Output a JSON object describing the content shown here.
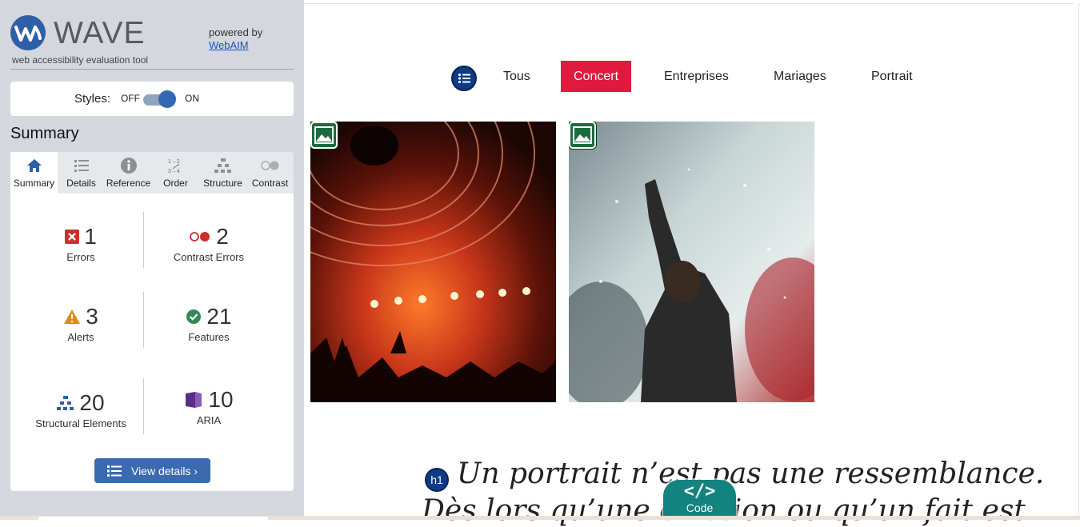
{
  "wave": {
    "logo_text": "WAVE",
    "logo_subtitle": "web accessibility evaluation tool",
    "powered_by": "powered by",
    "webaim_link": "WebAIM",
    "styles": {
      "label": "Styles:",
      "off": "OFF",
      "on": "ON",
      "state": "on"
    },
    "summary_title": "Summary",
    "tabs": [
      {
        "label": "Summary",
        "icon": "home-icon",
        "active": true
      },
      {
        "label": "Details",
        "icon": "list-icon"
      },
      {
        "label": "Reference",
        "icon": "info-icon"
      },
      {
        "label": "Order",
        "icon": "order-icon"
      },
      {
        "label": "Structure",
        "icon": "structure-icon"
      },
      {
        "label": "Contrast",
        "icon": "contrast-icon"
      }
    ],
    "stats": {
      "errors": {
        "count": "1",
        "label": "Errors",
        "color": "#c9302c"
      },
      "contrast_errors": {
        "count": "2",
        "label": "Contrast Errors",
        "color": "#c9302c"
      },
      "alerts": {
        "count": "3",
        "label": "Alerts",
        "color": "#e08a12"
      },
      "features": {
        "count": "21",
        "label": "Features",
        "color": "#2e8b57"
      },
      "structural": {
        "count": "20",
        "label": "Structural Elements",
        "color": "#2f5fa7"
      },
      "aria": {
        "count": "10",
        "label": "ARIA",
        "color": "#5b2d86"
      }
    },
    "view_details": "View details ›"
  },
  "page": {
    "nav": [
      "Tous",
      "Concert",
      "Entreprises",
      "Mariages",
      "Portrait"
    ],
    "active_nav": "Concert",
    "accent_color": "#e0193f",
    "h1_badge": "h1",
    "quote_line1": "Un portrait n’est pas une ressemblance.",
    "quote_line2": "Dès lors qu’une émotion ou qu’un fait est",
    "code_button": {
      "glyph": "</>",
      "label": "Code"
    }
  }
}
